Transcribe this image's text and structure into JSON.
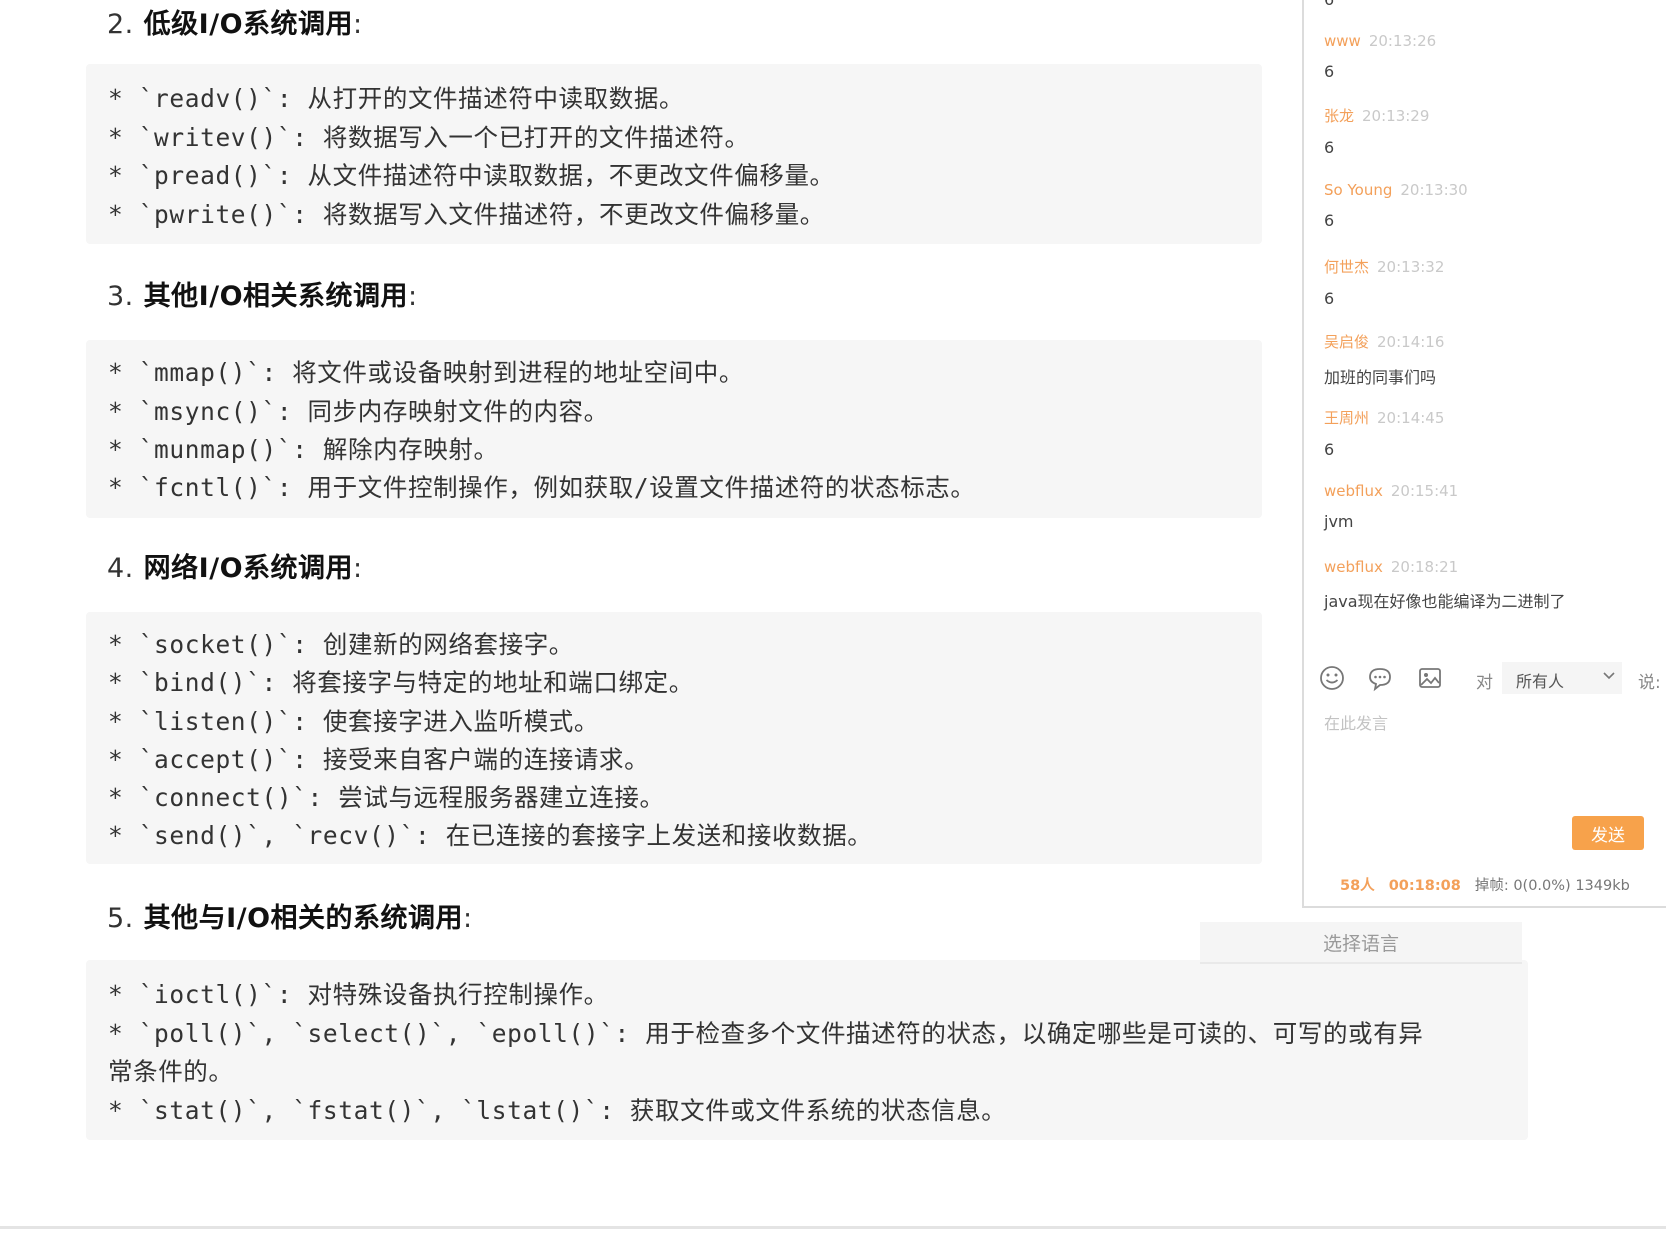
{
  "sections": [
    {
      "number": "2.",
      "title": "低级I/O系统调用",
      "colon": ":",
      "lines": [
        "* `readv()`: 从打开的文件描述符中读取数据。",
        "* `writev()`: 将数据写入一个已打开的文件描述符。",
        "* `pread()`: 从文件描述符中读取数据，不更改文件偏移量。",
        "* `pwrite()`: 将数据写入文件描述符，不更改文件偏移量。"
      ]
    },
    {
      "number": "3.",
      "title": "其他I/O相关系统调用",
      "colon": ":",
      "lines": [
        "* `mmap()`: 将文件或设备映射到进程的地址空间中。",
        "* `msync()`: 同步内存映射文件的内容。",
        "* `munmap()`: 解除内存映射。",
        "* `fcntl()`: 用于文件控制操作，例如获取/设置文件描述符的状态标志。"
      ]
    },
    {
      "number": "4.",
      "title": "网络I/O系统调用",
      "colon": ":",
      "lines": [
        "* `socket()`: 创建新的网络套接字。",
        "* `bind()`: 将套接字与特定的地址和端口绑定。",
        "* `listen()`: 使套接字进入监听模式。",
        "* `accept()`: 接受来自客户端的连接请求。",
        "* `connect()`: 尝试与远程服务器建立连接。",
        "* `send()`, `recv()`: 在已连接的套接字上发送和接收数据。"
      ]
    },
    {
      "number": "5.",
      "title": "其他与I/O相关的系统调用",
      "colon": ":",
      "lines": [
        "* `ioctl()`: 对特殊设备执行控制操作。",
        "* `poll()`, `select()`, `epoll()`: 用于检查多个文件描述符的状态，以确定哪些是可读的、可写的或有异",
        "常条件的。",
        "* `stat()`, `fstat()`, `lstat()`: 获取文件或文件系统的状态信息。"
      ]
    }
  ],
  "chat": {
    "top_partial_text": "6",
    "messages": [
      {
        "name": "www",
        "time": "20:13:26",
        "text": "6"
      },
      {
        "name": "张龙",
        "time": "20:13:29",
        "text": "6"
      },
      {
        "name": "So Young",
        "time": "20:13:30",
        "text": "6"
      },
      {
        "name": "何世杰",
        "time": "20:13:32",
        "text": "6"
      },
      {
        "name": "吴启俊",
        "time": "20:14:16",
        "text": "加班的同事们吗"
      },
      {
        "name": "王周州",
        "time": "20:14:45",
        "text": "6"
      },
      {
        "name": "webflux",
        "time": "20:15:41",
        "text": "jvm"
      },
      {
        "name": "webflux",
        "time": "20:18:21",
        "text": "java现在好像也能编译为二进制了"
      }
    ],
    "toolbar": {
      "icons": [
        "emoji-icon",
        "speech-bubble-icon",
        "image-icon"
      ],
      "to_label": "对",
      "audience": "所有人",
      "say_label": "说:"
    },
    "input_placeholder": "在此发言",
    "send_label": "发送",
    "status": {
      "viewers": "58人",
      "elapsed": "00:18:08",
      "loss_label": "掉帧:",
      "loss_value": "0(0.0%)",
      "bitrate": "1349kb"
    },
    "language_select": "选择语言"
  },
  "colors": {
    "accent": "#f3a05a",
    "send_button": "#f7a24b",
    "code_background": "#f6f6f6"
  }
}
